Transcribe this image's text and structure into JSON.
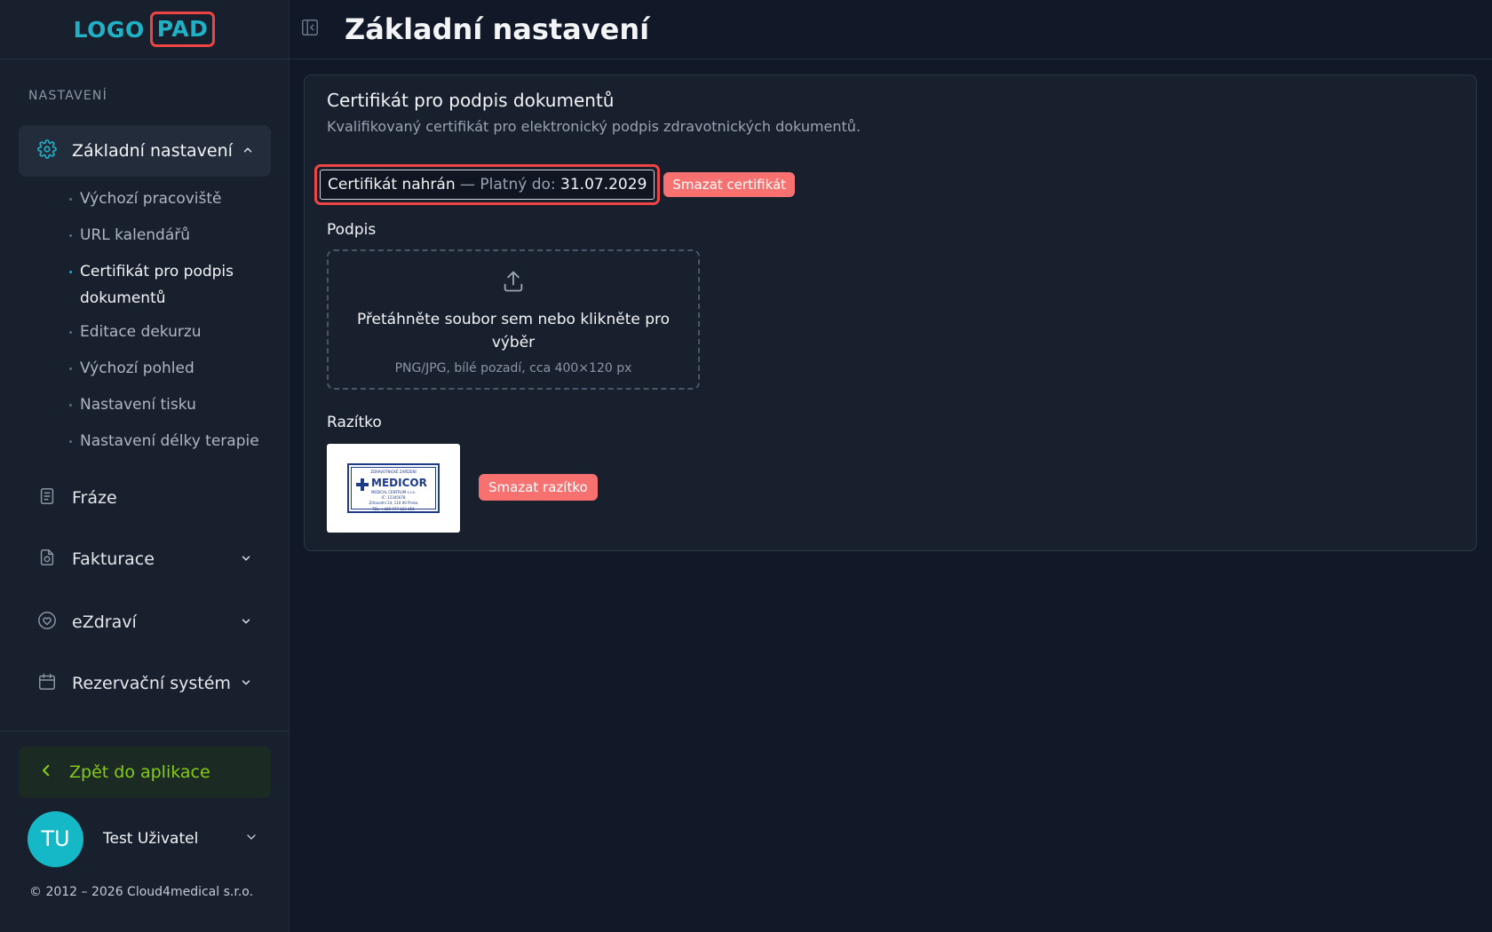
{
  "logo": {
    "part1": "LOGO",
    "part2": "PAD"
  },
  "sidebar": {
    "section_label": "NASTAVENÍ",
    "active_item": {
      "label": "Základní nastavení",
      "icon": "gear-icon"
    },
    "subitems": [
      "Výchozí pracoviště",
      "URL kalendářů",
      "Certifikát pro podpis dokumentů",
      "Editace dekurzu",
      "Výchozí pohled",
      "Nastavení tisku",
      "Nastavení délky terapie"
    ],
    "active_subitem_index": 2,
    "items": [
      {
        "label": "Fráze",
        "icon": "document-icon"
      },
      {
        "label": "Fakturace",
        "icon": "invoice-icon"
      },
      {
        "label": "eZdraví",
        "icon": "heart-icon"
      },
      {
        "label": "Rezervační systém",
        "icon": "calendar-icon"
      }
    ],
    "back_button": "Zpět do aplikace",
    "user": {
      "initials": "TU",
      "name": "Test Uživatel"
    },
    "copyright": "© 2012 – 2026 Cloud4medical s.r.o."
  },
  "header": {
    "title": "Základní nastavení"
  },
  "card": {
    "title": "Certifikát pro podpis dokumentů",
    "subtitle": "Kvalifikovaný certifikát pro elektronický podpis zdravotnických dokumentů.",
    "cert_status": "Certifikát nahrán",
    "cert_separator": " — Platný do: ",
    "cert_valid_until": "31.07.2029",
    "delete_cert": "Smazat certifikát",
    "signature_label": "Podpis",
    "dropzone_text": "Přetáhněte soubor sem nebo klikněte pro výběr",
    "dropzone_hint": "PNG/JPG, bílé pozadí, cca 400×120 px",
    "stamp_label": "Razítko",
    "delete_stamp": "Smazat razítko"
  },
  "stamp_image": {
    "top": "ZDRAVOTNICKÉ ZAŘÍZENÍ",
    "name": "MEDICOR",
    "sub": "MEDICAL CENTRUM s.r.o.",
    "ic": "IČ: 12345678",
    "address": "Zdravotní 24, 110 00 Praha",
    "tel": "TEL: +420 777 123 456"
  },
  "colors": {
    "accent": "#1fb1c6",
    "danger": "#f87171",
    "back": "#84cc16"
  }
}
